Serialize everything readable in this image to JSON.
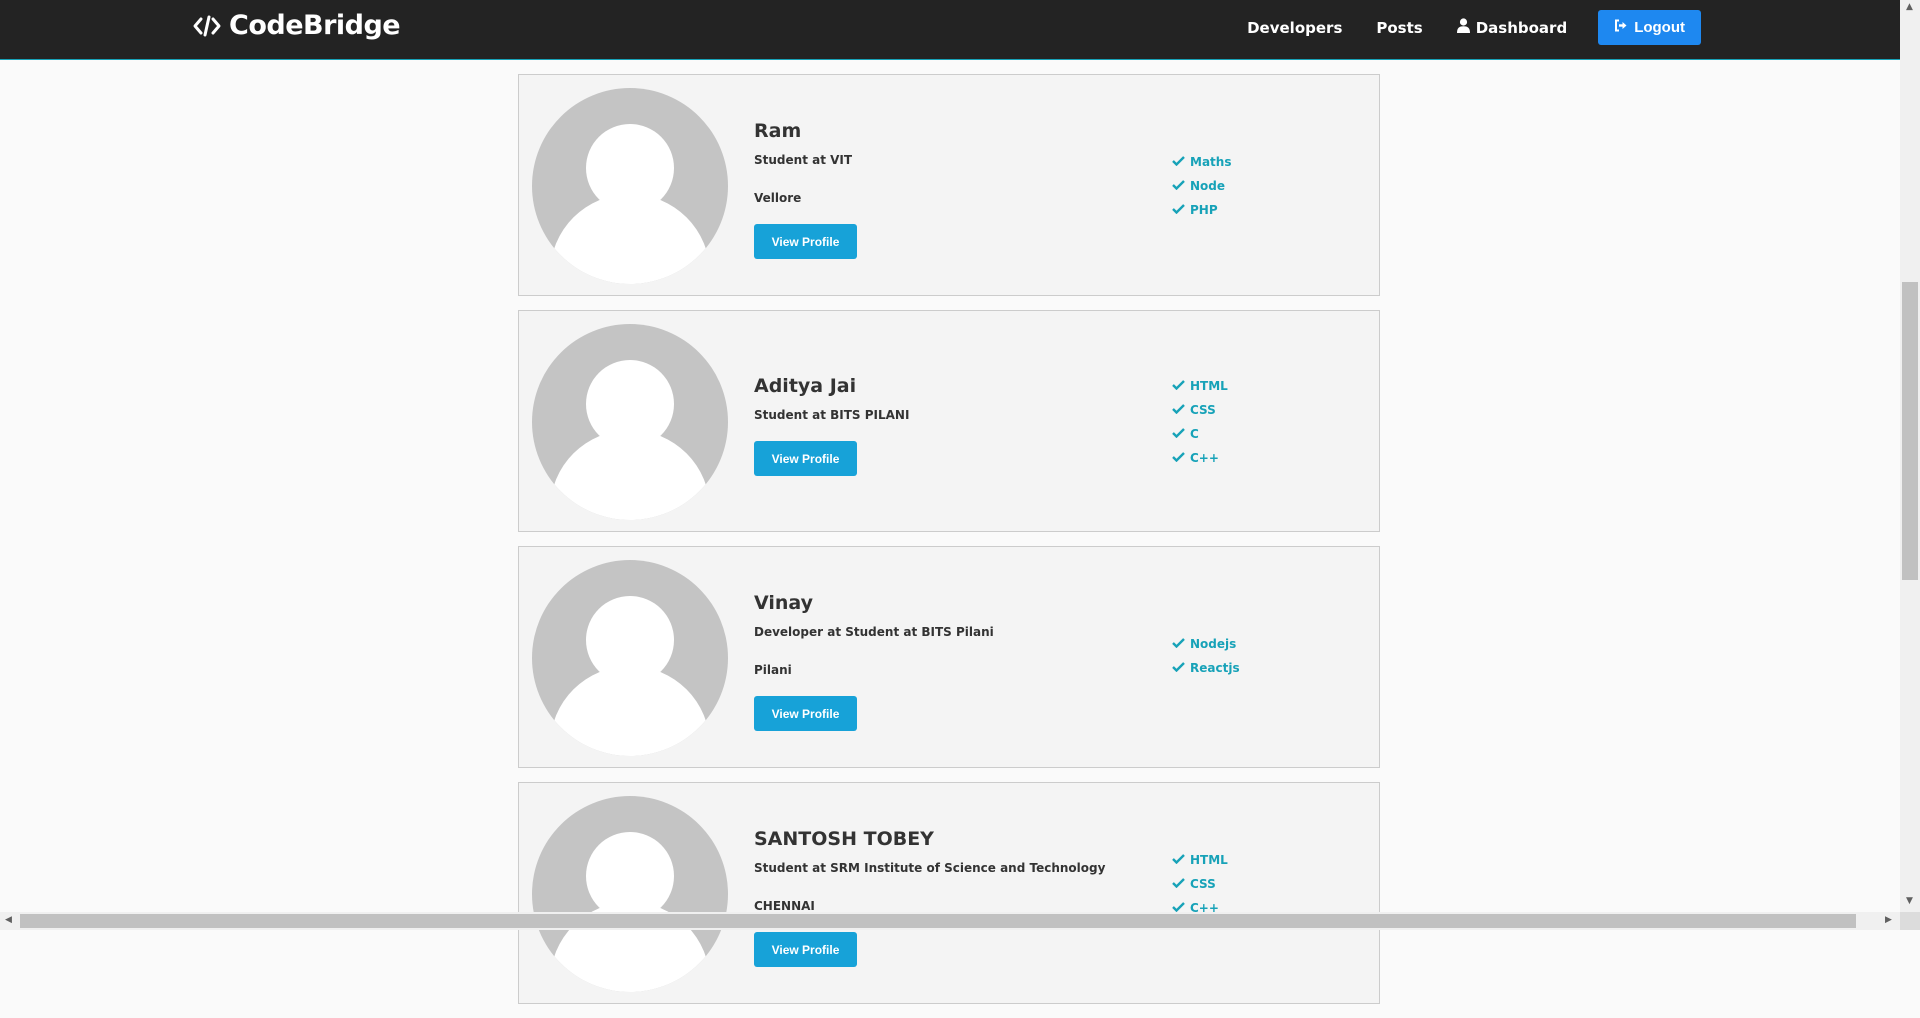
{
  "navbar": {
    "brand": "CodeBridge",
    "brand_icon": "code-icon",
    "links": {
      "developers": "Developers",
      "posts": "Posts",
      "dashboard": "Dashboard",
      "logout": "Logout"
    }
  },
  "profiles": [
    {
      "name": "Ram",
      "status": "Student at VIT",
      "location": "Vellore",
      "button": "View Profile",
      "skills": [
        "Maths",
        "Node",
        "PHP"
      ]
    },
    {
      "name": "Aditya Jai",
      "status": "Student at BITS PILANI",
      "location": "",
      "button": "View Profile",
      "skills": [
        "HTML",
        "CSS",
        "C",
        "C++"
      ]
    },
    {
      "name": "Vinay",
      "status": "Developer at Student at BITS Pilani",
      "location": "Pilani",
      "button": "View Profile",
      "skills": [
        "Nodejs",
        "Reactjs"
      ]
    },
    {
      "name": "SANTOSH TOBEY",
      "status": "Student at SRM Institute of Science and Technology",
      "location": "CHENNAI",
      "button": "View Profile",
      "skills": [
        "HTML",
        "CSS",
        "C++"
      ]
    }
  ],
  "colors": {
    "navbar_bg": "#232323",
    "accent": "#17a2b8",
    "logout_bg": "#1e88f0"
  }
}
